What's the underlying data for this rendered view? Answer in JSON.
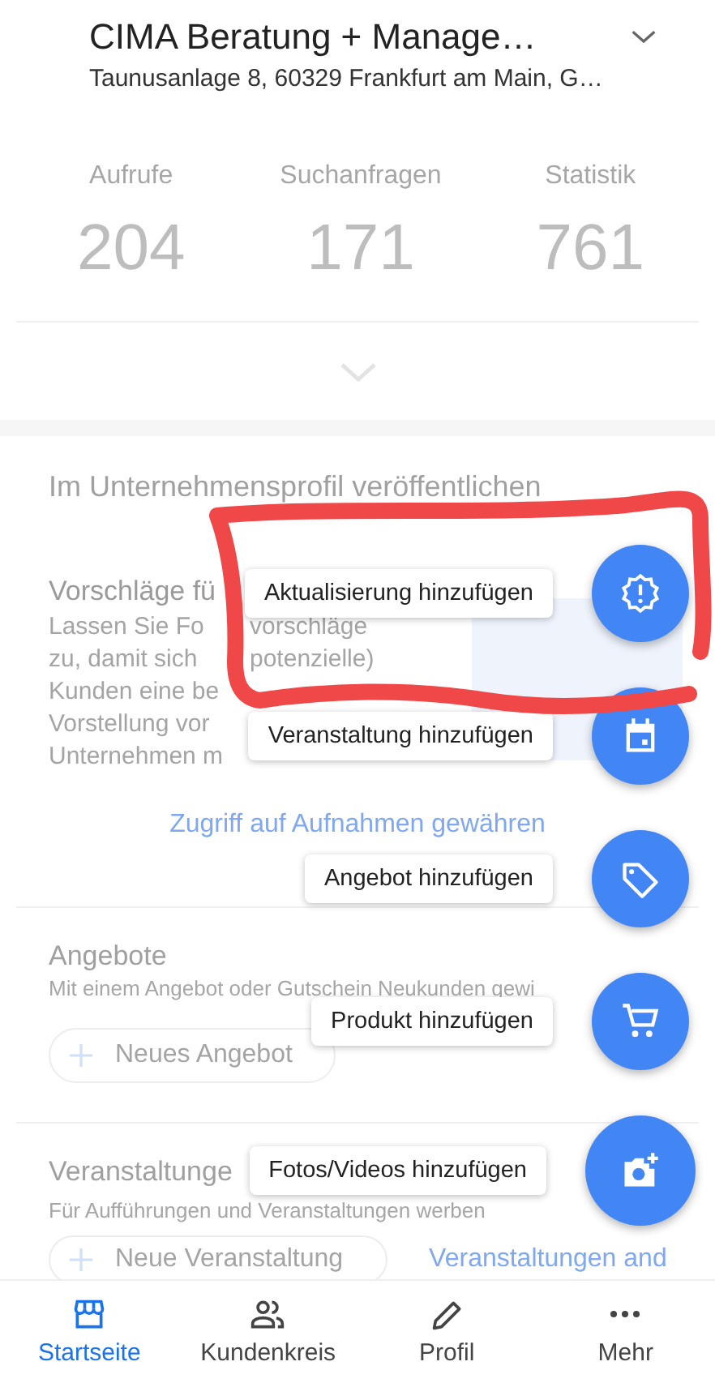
{
  "header": {
    "title": "CIMA Beratung + Manage…",
    "address": "Taunusanlage 8, 60329 Frankfurt am Main, G…"
  },
  "stats": [
    {
      "label": "Aufrufe",
      "value": "204"
    },
    {
      "label": "Suchanfragen",
      "value": "171"
    },
    {
      "label": "Statistik",
      "value": "761"
    }
  ],
  "publish": {
    "heading": "Im Unternehmensprofil veröffentlichen",
    "suggestion_title": "Vorschläge fü",
    "suggestion_lines": [
      [
        "Lassen Sie Fo",
        "vorschläge"
      ],
      [
        "zu, damit sich",
        "potenzielle)"
      ],
      [
        "Kunden eine be"
      ],
      [
        "Vorstellung vor"
      ],
      [
        "Unternehmen m"
      ]
    ],
    "link": "Zugriff auf Aufnahmen gewähren"
  },
  "offers": {
    "title": "Angebote",
    "subtitle": "Mit einem Angebot oder Gutschein Neukunden gewi",
    "button": "Neues Angebot"
  },
  "events": {
    "title": "Veranstaltunge",
    "subtitle": "Für Aufführungen und Veranstaltungen werben",
    "button": "Neue Veranstaltung",
    "link": "Veranstaltungen and"
  },
  "speed_dial": [
    {
      "label": "Aktualisierung hinzufügen",
      "kind": "update"
    },
    {
      "label": "Veranstaltung hinzufügen",
      "kind": "event"
    },
    {
      "label": "Angebot hinzufügen",
      "kind": "offer"
    },
    {
      "label": "Produkt hinzufügen",
      "kind": "product"
    },
    {
      "label": "Fotos/Videos hinzufügen",
      "kind": "photo"
    }
  ],
  "bottom_nav": [
    {
      "label": "Startseite",
      "kind": "store",
      "selected": true
    },
    {
      "label": "Kundenkreis",
      "kind": "people",
      "selected": false
    },
    {
      "label": "Profil",
      "kind": "pencil",
      "selected": false
    },
    {
      "label": "Mehr",
      "kind": "more",
      "selected": false
    }
  ]
}
